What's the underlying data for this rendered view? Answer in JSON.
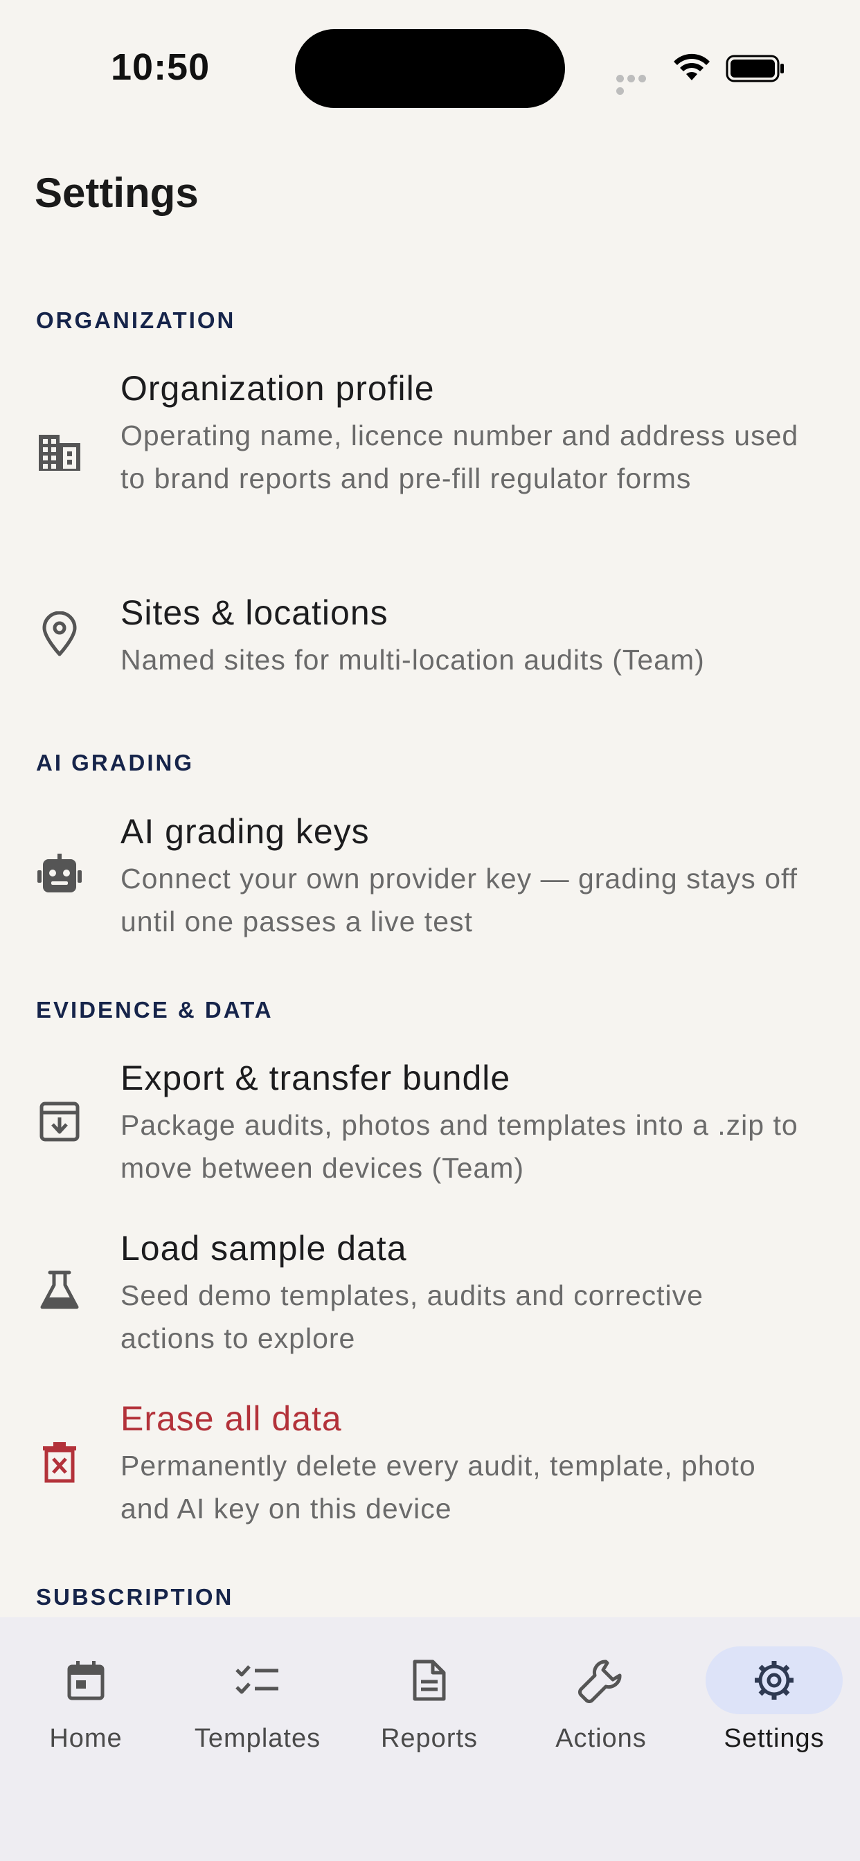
{
  "status_bar": {
    "time": "10:50"
  },
  "page": {
    "title": "Settings"
  },
  "sections": {
    "organization": "ORGANIZATION",
    "ai_grading": "AI GRADING",
    "evidence_data": "EVIDENCE & DATA",
    "subscription": "SUBSCRIPTION"
  },
  "items": {
    "org_profile": {
      "icon": "building-icon",
      "title": "Organization profile",
      "desc": "Operating name, licence number and address used to brand reports and pre-fill regulator forms"
    },
    "sites": {
      "icon": "location-pin-icon",
      "title": "Sites & locations",
      "desc": "Named sites for multi-location audits (Team)"
    },
    "ai_keys": {
      "icon": "robot-icon",
      "title": "AI grading keys",
      "desc": "Connect your own provider key — grading stays off until one passes a live test"
    },
    "export": {
      "icon": "archive-download-icon",
      "title": "Export & transfer bundle",
      "desc": "Package audits, photos and templates into a .zip to move between devices (Team)"
    },
    "sample": {
      "icon": "flask-icon",
      "title": "Load sample data",
      "desc": "Seed demo templates, audits and corrective actions to explore"
    },
    "erase": {
      "icon": "trash-icon",
      "title": "Erase all data",
      "desc": "Permanently delete every audit, template, photo and AI key on this device"
    }
  },
  "nav": {
    "home": "Home",
    "templates": "Templates",
    "reports": "Reports",
    "actions": "Actions",
    "settings": "Settings",
    "active": "settings"
  },
  "colors": {
    "background": "#f6f4f0",
    "section_header": "#16244a",
    "danger": "#b3323a",
    "nav_background": "#eeedf2",
    "nav_active_pill": "#dde3f8"
  }
}
